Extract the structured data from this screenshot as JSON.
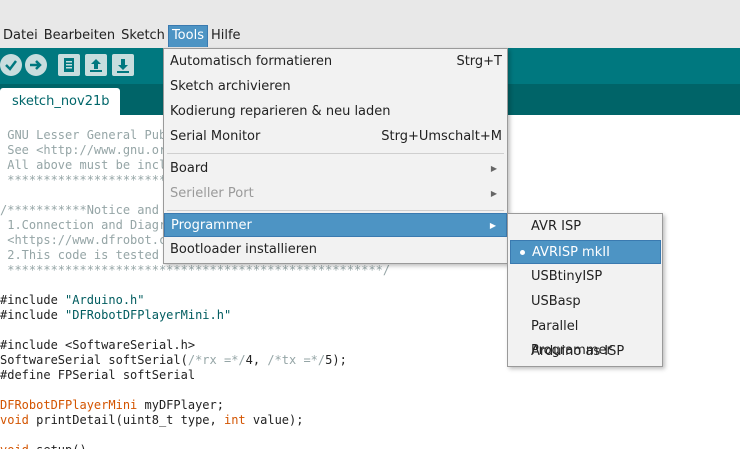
{
  "menubar": {
    "items": [
      "Datei",
      "Bearbeiten",
      "Sketch",
      "Tools",
      "Hilfe"
    ],
    "active": "Tools"
  },
  "toolbar": {
    "buttons": [
      "verify-icon",
      "upload-icon",
      "new-icon",
      "open-icon",
      "save-icon"
    ]
  },
  "tab": {
    "label": "sketch_nov21b"
  },
  "editor": {
    "lines": [
      {
        "parts": [
          {
            "t": " GNU Lesser General Publ",
            "c": "comment"
          }
        ]
      },
      {
        "parts": [
          {
            "t": " See <http://www.gnu.org",
            "c": "comment"
          }
        ]
      },
      {
        "parts": [
          {
            "t": " All above must be inclu",
            "c": "comment"
          }
        ]
      },
      {
        "parts": [
          {
            "t": " ***********************",
            "c": "comment"
          }
        ]
      },
      {
        "parts": [
          {
            "t": "",
            "c": "plain"
          }
        ]
      },
      {
        "parts": [
          {
            "t": "/***********Notice and T",
            "c": "comment"
          }
        ]
      },
      {
        "parts": [
          {
            "t": " 1.Connection and Diagra",
            "c": "comment"
          }
        ]
      },
      {
        "parts": [
          {
            "t": " <https://www.dfrobot.co",
            "c": "comment"
          }
        ]
      },
      {
        "parts": [
          {
            "t": " 2.This code is tested o",
            "c": "comment"
          }
        ]
      },
      {
        "parts": [
          {
            "t": " ****************************************************/",
            "c": "comment"
          }
        ]
      },
      {
        "parts": [
          {
            "t": "",
            "c": "plain"
          }
        ]
      },
      {
        "parts": [
          {
            "t": "#include ",
            "c": "plain"
          },
          {
            "t": "\"Arduino.h\"",
            "c": "string"
          }
        ]
      },
      {
        "parts": [
          {
            "t": "#include ",
            "c": "plain"
          },
          {
            "t": "\"DFRobotDFPlayerMini.h\"",
            "c": "string"
          }
        ]
      },
      {
        "parts": [
          {
            "t": "",
            "c": "plain"
          }
        ]
      },
      {
        "parts": [
          {
            "t": "#include <SoftwareSerial.h>",
            "c": "plain"
          }
        ]
      },
      {
        "parts": [
          {
            "t": "SoftwareSerial softSerial(",
            "c": "plain"
          },
          {
            "t": "/*rx =*/",
            "c": "comment"
          },
          {
            "t": "4, ",
            "c": "plain"
          },
          {
            "t": "/*tx =*/",
            "c": "comment"
          },
          {
            "t": "5);",
            "c": "plain"
          }
        ]
      },
      {
        "parts": [
          {
            "t": "#define FPSerial softSerial",
            "c": "plain"
          }
        ]
      },
      {
        "parts": [
          {
            "t": "",
            "c": "plain"
          }
        ]
      },
      {
        "parts": [
          {
            "t": "DFRobotDFPlayerMini",
            "c": "type"
          },
          {
            "t": " myDFPlayer;",
            "c": "plain"
          }
        ]
      },
      {
        "parts": [
          {
            "t": "void",
            "c": "kw"
          },
          {
            "t": " printDetail(uint8_t type, ",
            "c": "plain"
          },
          {
            "t": "int",
            "c": "kw"
          },
          {
            "t": " value);",
            "c": "plain"
          }
        ]
      },
      {
        "parts": [
          {
            "t": "",
            "c": "plain"
          }
        ]
      },
      {
        "parts": [
          {
            "t": "void",
            "c": "kw"
          },
          {
            "t": " setup()",
            "c": "plain"
          }
        ]
      }
    ]
  },
  "tools_menu": {
    "items": [
      {
        "label": "Automatisch formatieren",
        "shortcut": "Strg+T"
      },
      {
        "label": "Sketch archivieren",
        "shortcut": ""
      },
      {
        "label": "Kodierung reparieren & neu laden",
        "shortcut": ""
      },
      {
        "label": "Serial Monitor",
        "shortcut": "Strg+Umschalt+M"
      },
      {
        "label": "Board",
        "submenu": true
      },
      {
        "label": "Serieller Port",
        "submenu": true,
        "disabled": true
      },
      {
        "label": "Programmer",
        "submenu": true,
        "highlighted": true
      },
      {
        "label": "Bootloader installieren",
        "shortcut": ""
      }
    ]
  },
  "programmer_submenu": {
    "items": [
      "AVR ISP",
      "AVRISP mkII",
      "USBtinyISP",
      "USBasp",
      "Parallel Programmer",
      "Arduino as ISP"
    ],
    "selected": "AVRISP mkII"
  },
  "colors": {
    "toolbar": "#00787f",
    "tabbar": "#006468",
    "highlight": "#4d94c4"
  }
}
